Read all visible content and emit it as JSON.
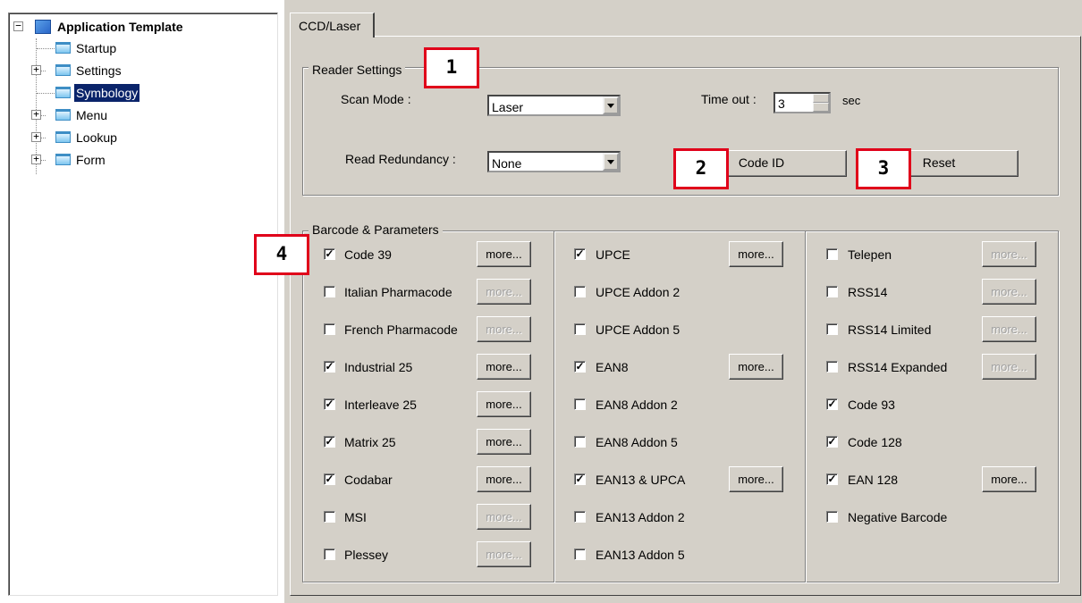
{
  "tree": {
    "root": "Application Template",
    "items": [
      {
        "label": "Startup",
        "expandable": false,
        "selected": false
      },
      {
        "label": "Settings",
        "expandable": true,
        "selected": false
      },
      {
        "label": "Symbology",
        "expandable": false,
        "selected": true
      },
      {
        "label": "Menu",
        "expandable": true,
        "selected": false
      },
      {
        "label": "Lookup",
        "expandable": true,
        "selected": false
      },
      {
        "label": "Form",
        "expandable": true,
        "selected": false
      }
    ]
  },
  "tab": {
    "label": "CCD/Laser"
  },
  "reader": {
    "title": "Reader Settings",
    "scan_mode_label": "Scan Mode :",
    "scan_mode_value": "Laser",
    "timeout_label": "Time out :",
    "timeout_value": "3",
    "timeout_unit": "sec",
    "redundancy_label": "Read Redundancy :",
    "redundancy_value": "None",
    "code_id_button": "Code ID",
    "reset_button": "Reset"
  },
  "barcode": {
    "title": "Barcode & Parameters",
    "more_label": "more...",
    "col1": [
      {
        "label": "Code 39",
        "checked": true,
        "more": "enabled"
      },
      {
        "label": "Italian Pharmacode",
        "checked": false,
        "more": "disabled"
      },
      {
        "label": "French Pharmacode",
        "checked": false,
        "more": "disabled"
      },
      {
        "label": "Industrial 25",
        "checked": true,
        "more": "enabled"
      },
      {
        "label": "Interleave 25",
        "checked": true,
        "more": "enabled"
      },
      {
        "label": "Matrix 25",
        "checked": true,
        "more": "enabled"
      },
      {
        "label": "Codabar",
        "checked": true,
        "more": "enabled"
      },
      {
        "label": "MSI",
        "checked": false,
        "more": "disabled"
      },
      {
        "label": "Plessey",
        "checked": false,
        "more": "disabled"
      }
    ],
    "col2": [
      {
        "label": "UPCE",
        "checked": true,
        "more": "enabled"
      },
      {
        "label": "UPCE Addon 2",
        "checked": false,
        "more": "none"
      },
      {
        "label": "UPCE Addon 5",
        "checked": false,
        "more": "none"
      },
      {
        "label": "EAN8",
        "checked": true,
        "more": "enabled"
      },
      {
        "label": "EAN8 Addon 2",
        "checked": false,
        "more": "none"
      },
      {
        "label": "EAN8 Addon 5",
        "checked": false,
        "more": "none"
      },
      {
        "label": "EAN13 & UPCA",
        "checked": true,
        "more": "enabled"
      },
      {
        "label": "EAN13 Addon 2",
        "checked": false,
        "more": "none"
      },
      {
        "label": "EAN13 Addon 5",
        "checked": false,
        "more": "none"
      }
    ],
    "col3": [
      {
        "label": "Telepen",
        "checked": false,
        "more": "disabled"
      },
      {
        "label": "RSS14",
        "checked": false,
        "more": "disabled"
      },
      {
        "label": "RSS14 Limited",
        "checked": false,
        "more": "disabled"
      },
      {
        "label": "RSS14 Expanded",
        "checked": false,
        "more": "disabled"
      },
      {
        "label": "Code 93",
        "checked": true,
        "more": "none"
      },
      {
        "label": "Code 128",
        "checked": true,
        "more": "none"
      },
      {
        "label": "EAN 128",
        "checked": true,
        "more": "enabled"
      },
      {
        "label": "Negative Barcode",
        "checked": false,
        "more": "none"
      }
    ]
  },
  "callouts": [
    "1",
    "2",
    "3",
    "4"
  ],
  "colors": {
    "callout_border": "#e0001a",
    "selection": "#0a246a",
    "face": "#d4d0c8"
  }
}
